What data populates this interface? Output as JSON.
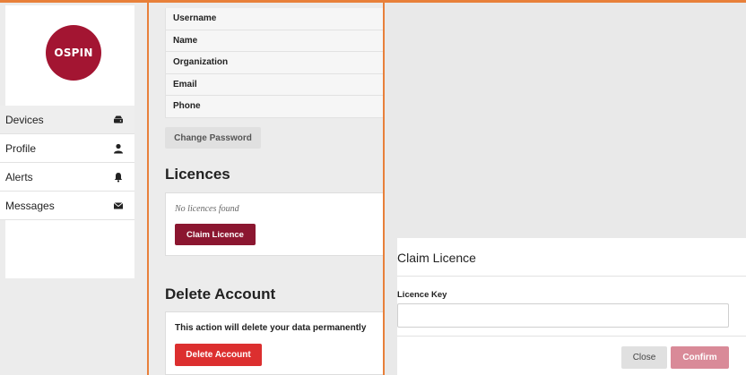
{
  "brand": {
    "logo_text": "OSPIN",
    "logo_color": "#a31532"
  },
  "sidebar": {
    "items": [
      {
        "label": "Devices",
        "icon": "server-icon",
        "active": true
      },
      {
        "label": "Profile",
        "icon": "user-icon",
        "active": false
      },
      {
        "label": "Alerts",
        "icon": "bell-icon",
        "active": false
      },
      {
        "label": "Messages",
        "icon": "envelope-icon",
        "active": false
      }
    ]
  },
  "profile": {
    "fields": [
      {
        "label": "Username"
      },
      {
        "label": "Name"
      },
      {
        "label": "Organization"
      },
      {
        "label": "Email"
      },
      {
        "label": "Phone"
      }
    ],
    "change_password_label": "Change Password"
  },
  "licences": {
    "heading": "Licences",
    "empty_text": "No licences found",
    "claim_button_label": "Claim Licence",
    "claim_button_color": "#8b1630"
  },
  "delete_account": {
    "heading": "Delete Account",
    "warning_text": "This action will delete your data permanently",
    "button_label": "Delete Account",
    "button_color": "#dc2f2f"
  },
  "modal": {
    "title": "Claim Licence",
    "field_label": "Licence Key",
    "field_value": "",
    "close_label": "Close",
    "confirm_label": "Confirm",
    "confirm_color": "#d98a98"
  },
  "colors": {
    "accent_frame": "#e8803a"
  }
}
